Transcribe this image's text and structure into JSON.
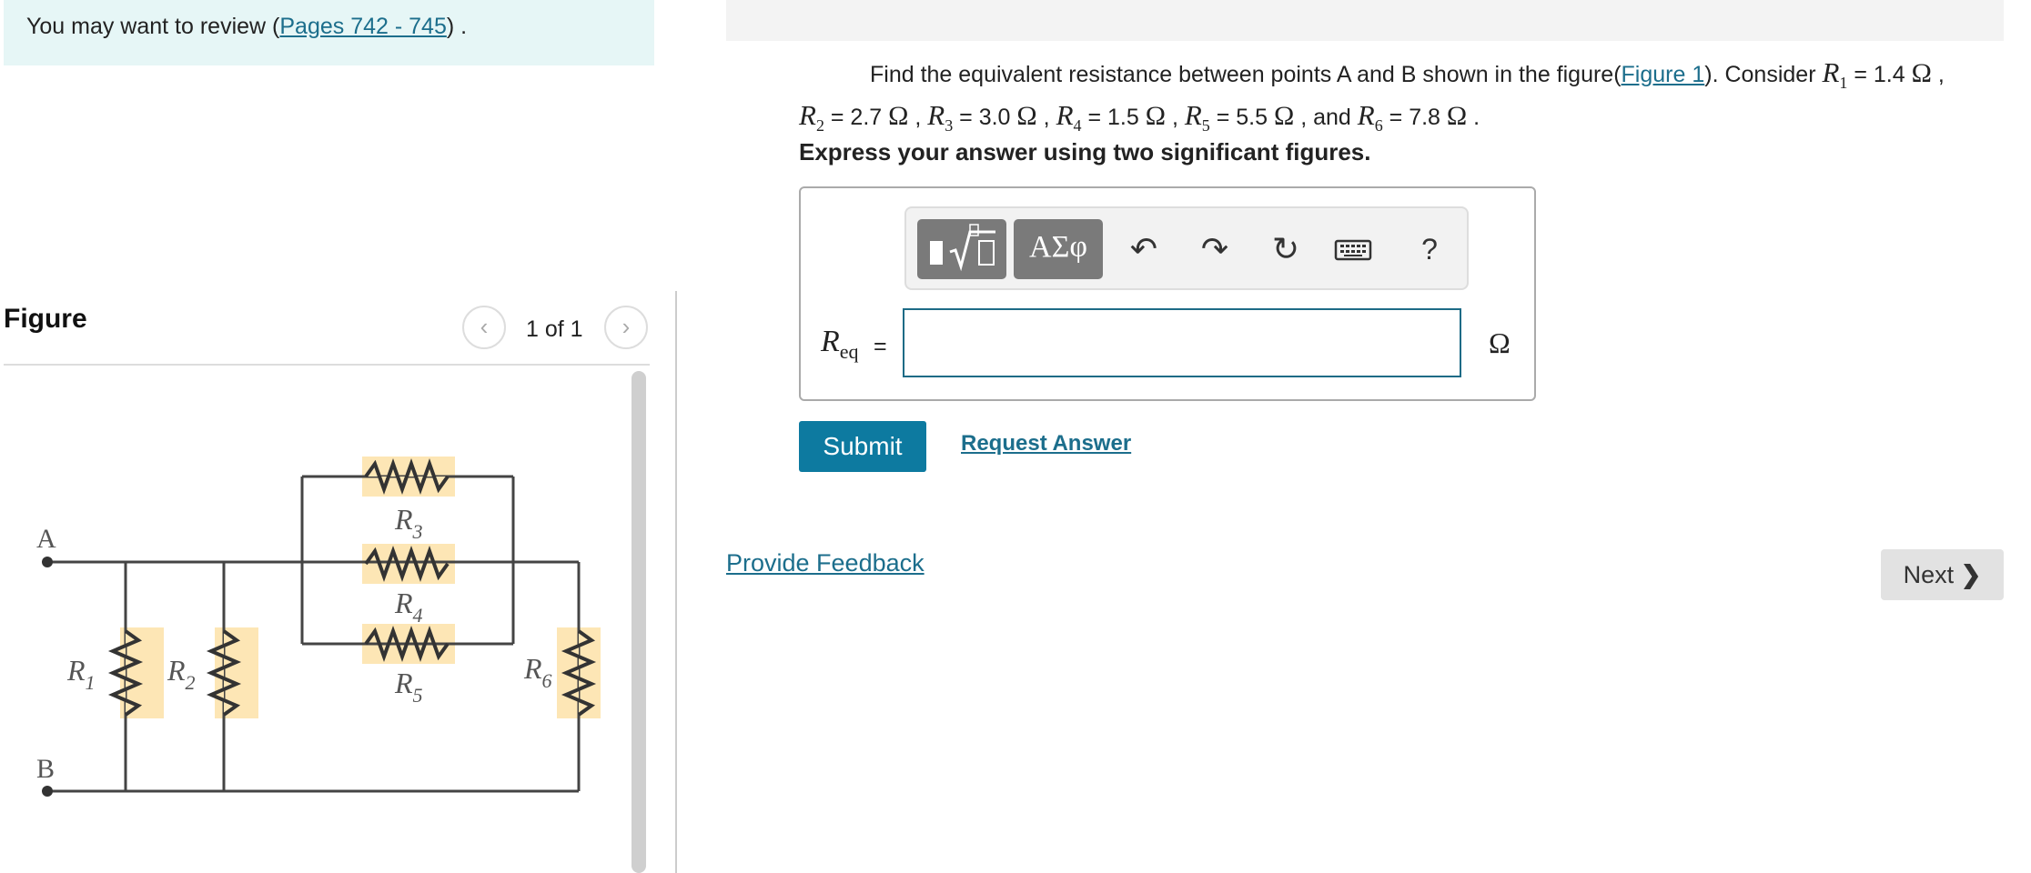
{
  "review": {
    "prefix": "You may want to review (",
    "link": "Pages 742 - 745",
    "suffix": ") ."
  },
  "figure_panel": {
    "title": "Figure",
    "pager": "1 of 1",
    "prev_icon": "chevron-left-icon",
    "next_icon": "chevron-right-icon"
  },
  "circuit": {
    "nodes": [
      "A",
      "B"
    ],
    "resistors": [
      {
        "name": "R",
        "sub": "1"
      },
      {
        "name": "R",
        "sub": "2"
      },
      {
        "name": "R",
        "sub": "3"
      },
      {
        "name": "R",
        "sub": "4"
      },
      {
        "name": "R",
        "sub": "5"
      },
      {
        "name": "R",
        "sub": "6"
      }
    ]
  },
  "problem": {
    "text1": "Find the equivalent resistance between points A and B shown in the figure(",
    "figure_link": "Figure 1",
    "text2": "). Consider ",
    "values": [
      {
        "sym": "R",
        "sub": "1",
        "val": " = 1.4 ",
        "sep": " ,"
      },
      {
        "sym": "R",
        "sub": "2",
        "val": " = 2.7 ",
        "sep": " , "
      },
      {
        "sym": "R",
        "sub": "3",
        "val": " = 3.0 ",
        "sep": " , "
      },
      {
        "sym": "R",
        "sub": "4",
        "val": " = 1.5 ",
        "sep": " , "
      },
      {
        "sym": "R",
        "sub": "5",
        "val": " = 5.5 ",
        "sep": " , and "
      },
      {
        "sym": "R",
        "sub": "6",
        "val": " = 7.8 ",
        "sep": " ."
      }
    ],
    "ohm": "Ω",
    "instruction": "Express your answer using two significant figures."
  },
  "answer": {
    "label_sym": "R",
    "label_sub": "eq",
    "equals": "=",
    "value": "",
    "unit": "Ω"
  },
  "toolbar": {
    "greek": "ΑΣφ",
    "help": "?",
    "icons": [
      "templates-icon",
      "greek-letters-icon",
      "undo-icon",
      "redo-icon",
      "reset-icon",
      "keyboard-icon",
      "help-icon"
    ]
  },
  "actions": {
    "submit": "Submit",
    "request_answer": "Request Answer",
    "provide_feedback": "Provide Feedback",
    "next": "Next"
  },
  "colors": {
    "accent": "#0d7aa0",
    "link": "#1c6e8c",
    "review_bg": "#e6f6f6",
    "resistor_highlight": "#fde6b5"
  }
}
